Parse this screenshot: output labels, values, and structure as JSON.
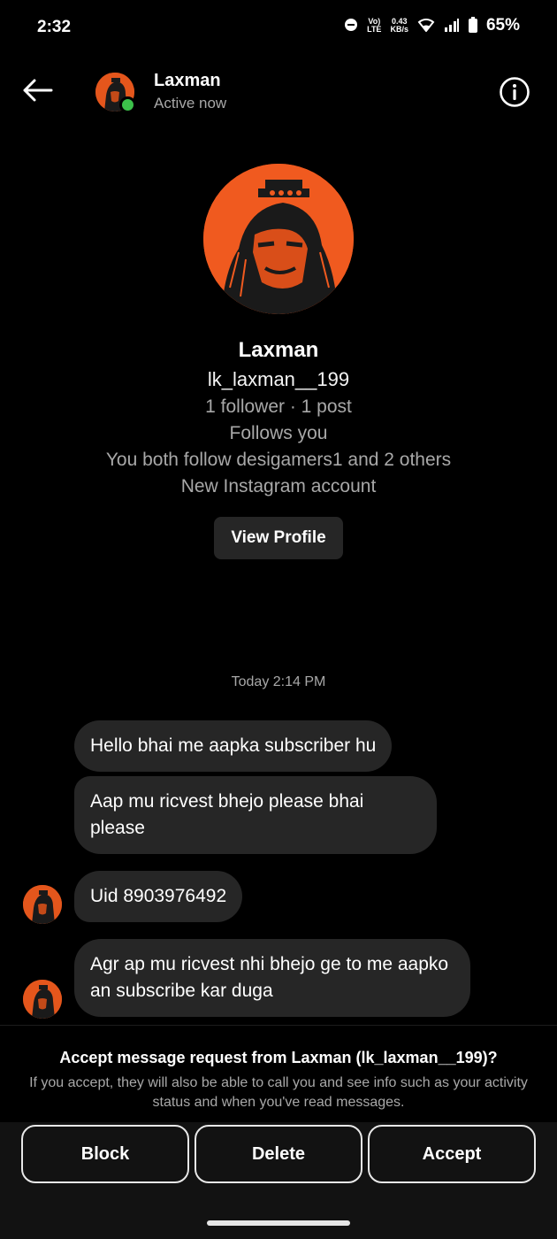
{
  "status_bar": {
    "time": "2:32",
    "net_speed_value": "0.43",
    "net_speed_unit": "KB/s",
    "volte_top": "Vo)",
    "volte_bottom": "LTE",
    "battery": "65%"
  },
  "header": {
    "name": "Laxman",
    "status": "Active now"
  },
  "profile": {
    "name": "Laxman",
    "username": "lk_laxman__199",
    "stats": "1 follower · 1 post",
    "follows_you": "Follows you",
    "mutuals": "You both follow desigamers1 and 2 others",
    "account_note": "New Instagram account",
    "view_profile_label": "View Profile"
  },
  "messages": {
    "timestamp": "Today 2:14 PM",
    "items": [
      "Hello bhai me aapka subscriber hu",
      "Aap mu ricvest bhejo please bhai please",
      "Uid 8903976492",
      "Agr ap mu ricvest nhi bhejo ge to me aapko an subscribe kar duga"
    ]
  },
  "request": {
    "title_prefix": "Accept message request from ",
    "title_name": "Laxman (lk_laxman__199)",
    "title_suffix": "?",
    "description": "If you accept, they will also be able to call you and see info such as your activity status and when you've read messages."
  },
  "actions": {
    "block": "Block",
    "delete": "Delete",
    "accept": "Accept"
  },
  "colors": {
    "background": "#000000",
    "bubble": "#262626",
    "avatar_orange": "#f05a1f",
    "online_green": "#3cc14a",
    "muted_text": "#a8a8a8"
  }
}
